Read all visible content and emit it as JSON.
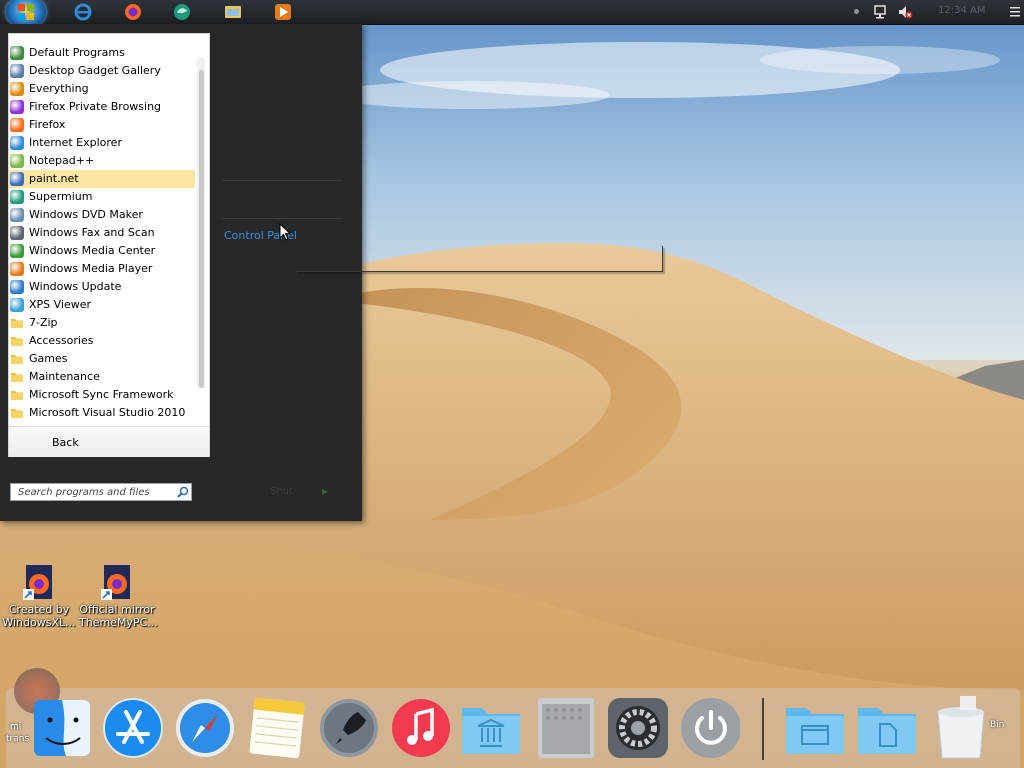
{
  "start_menu": {
    "programs": [
      {
        "label": "Default Programs",
        "icon": "default-programs-icon",
        "color": "#3c8c3c"
      },
      {
        "label": "Desktop Gadget Gallery",
        "icon": "gadget-icon",
        "color": "#5a7db0"
      },
      {
        "label": "Everything",
        "icon": "magnifier-icon",
        "color": "#e08a10"
      },
      {
        "label": "Firefox Private Browsing",
        "icon": "firefox-private-icon",
        "color": "#8d2ed8"
      },
      {
        "label": "Firefox",
        "icon": "firefox-icon",
        "color": "#ff6a1a"
      },
      {
        "label": "Internet Explorer",
        "icon": "ie-icon",
        "color": "#2f8ad8"
      },
      {
        "label": "Notepad++",
        "icon": "notepadpp-icon",
        "color": "#7bb843"
      },
      {
        "label": "paint.net",
        "icon": "paintnet-icon",
        "color": "#3d6eb5"
      },
      {
        "label": "Supermium",
        "icon": "supermium-icon",
        "color": "#1e9a7a"
      },
      {
        "label": "Windows DVD Maker",
        "icon": "dvd-icon",
        "color": "#6a8db5"
      },
      {
        "label": "Windows Fax and Scan",
        "icon": "fax-icon",
        "color": "#5c6470"
      },
      {
        "label": "Windows Media Center",
        "icon": "media-center-icon",
        "color": "#3b9a3b"
      },
      {
        "label": "Windows Media Player",
        "icon": "media-player-icon",
        "color": "#e87a1a"
      },
      {
        "label": "Windows Update",
        "icon": "update-icon",
        "color": "#2c7ad0"
      },
      {
        "label": "XPS Viewer",
        "icon": "xps-icon",
        "color": "#3aa0d8"
      },
      {
        "label": "7-Zip",
        "icon": "folder-icon",
        "color": "#e8c040"
      },
      {
        "label": "Accessories",
        "icon": "folder-icon",
        "color": "#e8c040"
      },
      {
        "label": "Games",
        "icon": "folder-icon",
        "color": "#e8c040"
      },
      {
        "label": "Maintenance",
        "icon": "folder-icon",
        "color": "#e8c040"
      },
      {
        "label": "Microsoft Sync Framework",
        "icon": "folder-icon",
        "color": "#e8c040"
      },
      {
        "label": "Microsoft Visual Studio 2010",
        "icon": "folder-icon",
        "color": "#e8c040"
      }
    ],
    "selected_index": 7,
    "back_label": "Back",
    "search_placeholder": "Search programs and files",
    "control_panel_label": "Control Panel",
    "shutdown_label": "Shut"
  },
  "desktop_icons": [
    {
      "label_line1": "Created by",
      "label_line2": "WindowsXL..."
    },
    {
      "label_line1": "Official mirror",
      "label_line2": "ThemeMyPC..."
    }
  ],
  "taskbar": {
    "clock": "12:34 AM"
  },
  "dock": {
    "items": [
      "finder-icon",
      "app-store-icon",
      "safari-icon",
      "notes-icon",
      "launchpad-icon",
      "music-icon",
      "applications-folder-icon",
      "mac-pro-icon",
      "system-preferences-icon",
      "power-icon",
      "documents-folder-icon",
      "downloads-folder-icon",
      "trash-icon"
    ],
    "edge_labels": [
      "mi",
      "trans",
      "Bin"
    ]
  },
  "colors": {
    "menu_bg": "#262829",
    "selection": "#fbe6a4",
    "link": "#3a8fd8"
  }
}
